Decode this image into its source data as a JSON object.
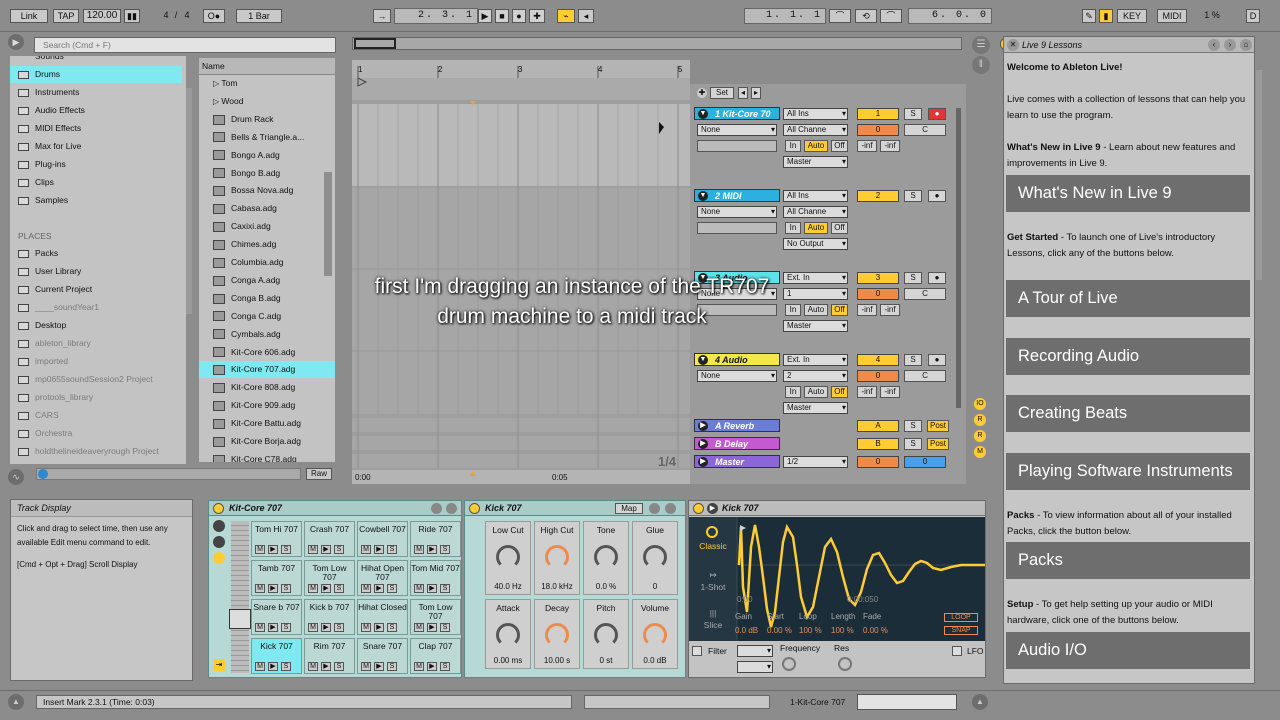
{
  "transport": {
    "link": "Link",
    "tap": "TAP",
    "tempo": "120.00",
    "meter_num": "4",
    "meter_sep": "/",
    "meter_den": "4",
    "quantize": "1 Bar",
    "position": "2.  3.  1",
    "loop_start": "1.  1.  1",
    "loop_length": "6.  0.  0",
    "key": "KEY",
    "midi": "MIDI",
    "cpu": "1 %",
    "d": "D"
  },
  "browser": {
    "search_placeholder": "Search (Cmd + F)",
    "categories": [
      "Sounds",
      "Drums",
      "Instruments",
      "Audio Effects",
      "MIDI Effects",
      "Max for Live",
      "Plug-ins",
      "Clips",
      "Samples"
    ],
    "places_title": "PLACES",
    "places": [
      "Packs",
      "User Library",
      "Current Project",
      "____soundYear1",
      "Desktop",
      "ableton_library",
      "imported",
      "mp0655soundSession2 Project",
      "protools_library",
      "CARS",
      "Orchestra",
      "holdthelineideaveryrough Project"
    ],
    "name_header": "Name",
    "items": [
      "Tom",
      "Wood",
      "Drum Rack",
      "Bells & Triangle.a...",
      "Bongo A.adg",
      "Bongo B.adg",
      "Bossa Nova.adg",
      "Cabasa.adg",
      "Caxixi.adg",
      "Chimes.adg",
      "Columbia.adg",
      "Conga A.adg",
      "Conga B.adg",
      "Conga C.adg",
      "Cymbals.adg",
      "Kit-Core 606.adg",
      "Kit-Core 707.adg",
      "Kit-Core 808.adg",
      "Kit-Core 909.adg",
      "Kit-Core Battu.adg",
      "Kit-Core Borja.adg",
      "Kit-Core C78.adg"
    ],
    "raw": "Raw"
  },
  "arrangement": {
    "ruler": [
      "1",
      "2",
      "3",
      "4",
      "5"
    ],
    "time_start": "0:00",
    "time_mid": "0:05",
    "zoom": "1/4",
    "set": "Set"
  },
  "tracks": [
    {
      "name": "1 Kit-Core 70",
      "color": "#2cb0e0",
      "input": "All Ins",
      "chan": "All Channe",
      "monitor_none": "None",
      "out": "Master",
      "num": "1",
      "vol": "0",
      "pan": "C"
    },
    {
      "name": "2 MIDI",
      "color": "#2cb0e0",
      "input": "All Ins",
      "chan": "All Channe",
      "monitor_none": "None",
      "out": "No Output",
      "num": "2"
    },
    {
      "name": "3 Audio",
      "color": "#5de2ea",
      "input": "Ext. In",
      "chan": "1",
      "monitor_none": "None",
      "out": "Master",
      "num": "3",
      "vol": "0",
      "pan": "C"
    },
    {
      "name": "4 Audio",
      "color": "#f2e84b",
      "input": "Ext. In",
      "chan": "2",
      "monitor_none": "None",
      "out": "Master",
      "num": "4",
      "vol": "0",
      "pan": "C"
    }
  ],
  "returns": [
    {
      "name": "A Reverb",
      "color": "#6a7ed8",
      "letter": "A",
      "post": "Post"
    },
    {
      "name": "B Delay",
      "color": "#c45ad0",
      "letter": "B",
      "post": "Post"
    }
  ],
  "master": {
    "name": "Master",
    "color": "#8a66d8",
    "cue": "1/2",
    "vol": "0",
    "pan": "0"
  },
  "mixer_labels": {
    "in": "In",
    "auto": "Auto",
    "off": "Off",
    "inf": "-inf",
    "s": "S"
  },
  "caption": "first I'm dragging an instance of the TR707 drum machine to a midi track",
  "info": {
    "title": "Track Display",
    "body": "Click and drag to select time, then use any available Edit menu command to edit.",
    "body2": "[Cmd + Opt + Drag] Scroll Display"
  },
  "drumrack": {
    "title": "Kit-Core 707",
    "pads": [
      [
        "Tom Hi 707",
        "Crash 707",
        "Cowbell 707",
        "Ride 707"
      ],
      [
        "Tamb 707",
        "Tom Low 707",
        "Hihat Open 707",
        "Tom Mid 707"
      ],
      [
        "Snare b 707",
        "Kick b 707",
        "Hihat Closed",
        "Tom Low 707"
      ],
      [
        "Kick 707",
        "Rim 707",
        "Snare 707",
        "Clap 707"
      ]
    ],
    "m": "M",
    "s": "S"
  },
  "kick": {
    "title": "Kick 707",
    "map": "Map",
    "knobs": [
      {
        "label": "Low Cut",
        "value": "40.0 Hz"
      },
      {
        "label": "High Cut",
        "value": "18.0 kHz"
      },
      {
        "label": "Tone",
        "value": "0.0 %"
      },
      {
        "label": "Glue",
        "value": "0"
      },
      {
        "label": "Attack",
        "value": "0.00 ms"
      },
      {
        "label": "Decay",
        "value": "10.00 s"
      },
      {
        "label": "Pitch",
        "value": "0 st"
      },
      {
        "label": "Volume",
        "value": "0.0 dB"
      }
    ]
  },
  "sampler": {
    "title": "Kick 707",
    "mode": "Classic",
    "oneshot": "1-Shot",
    "slice": "Slice",
    "t0": "0:00",
    "t1": "0:00:050",
    "params": [
      {
        "label": "Gain",
        "value": "0.0 dB"
      },
      {
        "label": "Start",
        "value": "0.00 %"
      },
      {
        "label": "Loop",
        "value": "100 %"
      },
      {
        "label": "Length",
        "value": "100 %"
      },
      {
        "label": "Fade",
        "value": "0.00 %"
      }
    ],
    "loop": "LOOP",
    "snap": "SNAP",
    "filter": "Filter",
    "frequency": "Frequency",
    "res": "Res",
    "lfo": "LFO"
  },
  "lessons": {
    "title": "Live 9 Lessons",
    "welcome": "Welcome to Ableton Live!",
    "intro": "Live comes with a collection of lessons that can help you learn to use the program.",
    "whats_new_lbl": "What's New in Live 9",
    "whats_new_txt": " - Learn about new features and improvements in Live 9.",
    "btn_new": "What's New in Live 9",
    "getstarted_lbl": "Get Started",
    "getstarted_txt": " - To launch one of Live's introductory Lessons, click any of the buttons below.",
    "btns": [
      "A Tour of Live",
      "Recording Audio",
      "Creating Beats",
      "Playing Software Instruments"
    ],
    "packs_lbl": "Packs",
    "packs_txt": " - To view information about all of your installed Packs, click the button below.",
    "btn_packs": "Packs",
    "setup_lbl": "Setup",
    "setup_txt": " - To get help setting up your audio or MIDI hardware, click one of the buttons below.",
    "btn_audio": "Audio I/O"
  },
  "status": {
    "message": "Insert Mark 2.3.1 (Time: 0:03)",
    "track": "1-Kit-Core 707"
  },
  "colors": {
    "accent": "#ffcc33",
    "selected": "#7fe8f0"
  }
}
